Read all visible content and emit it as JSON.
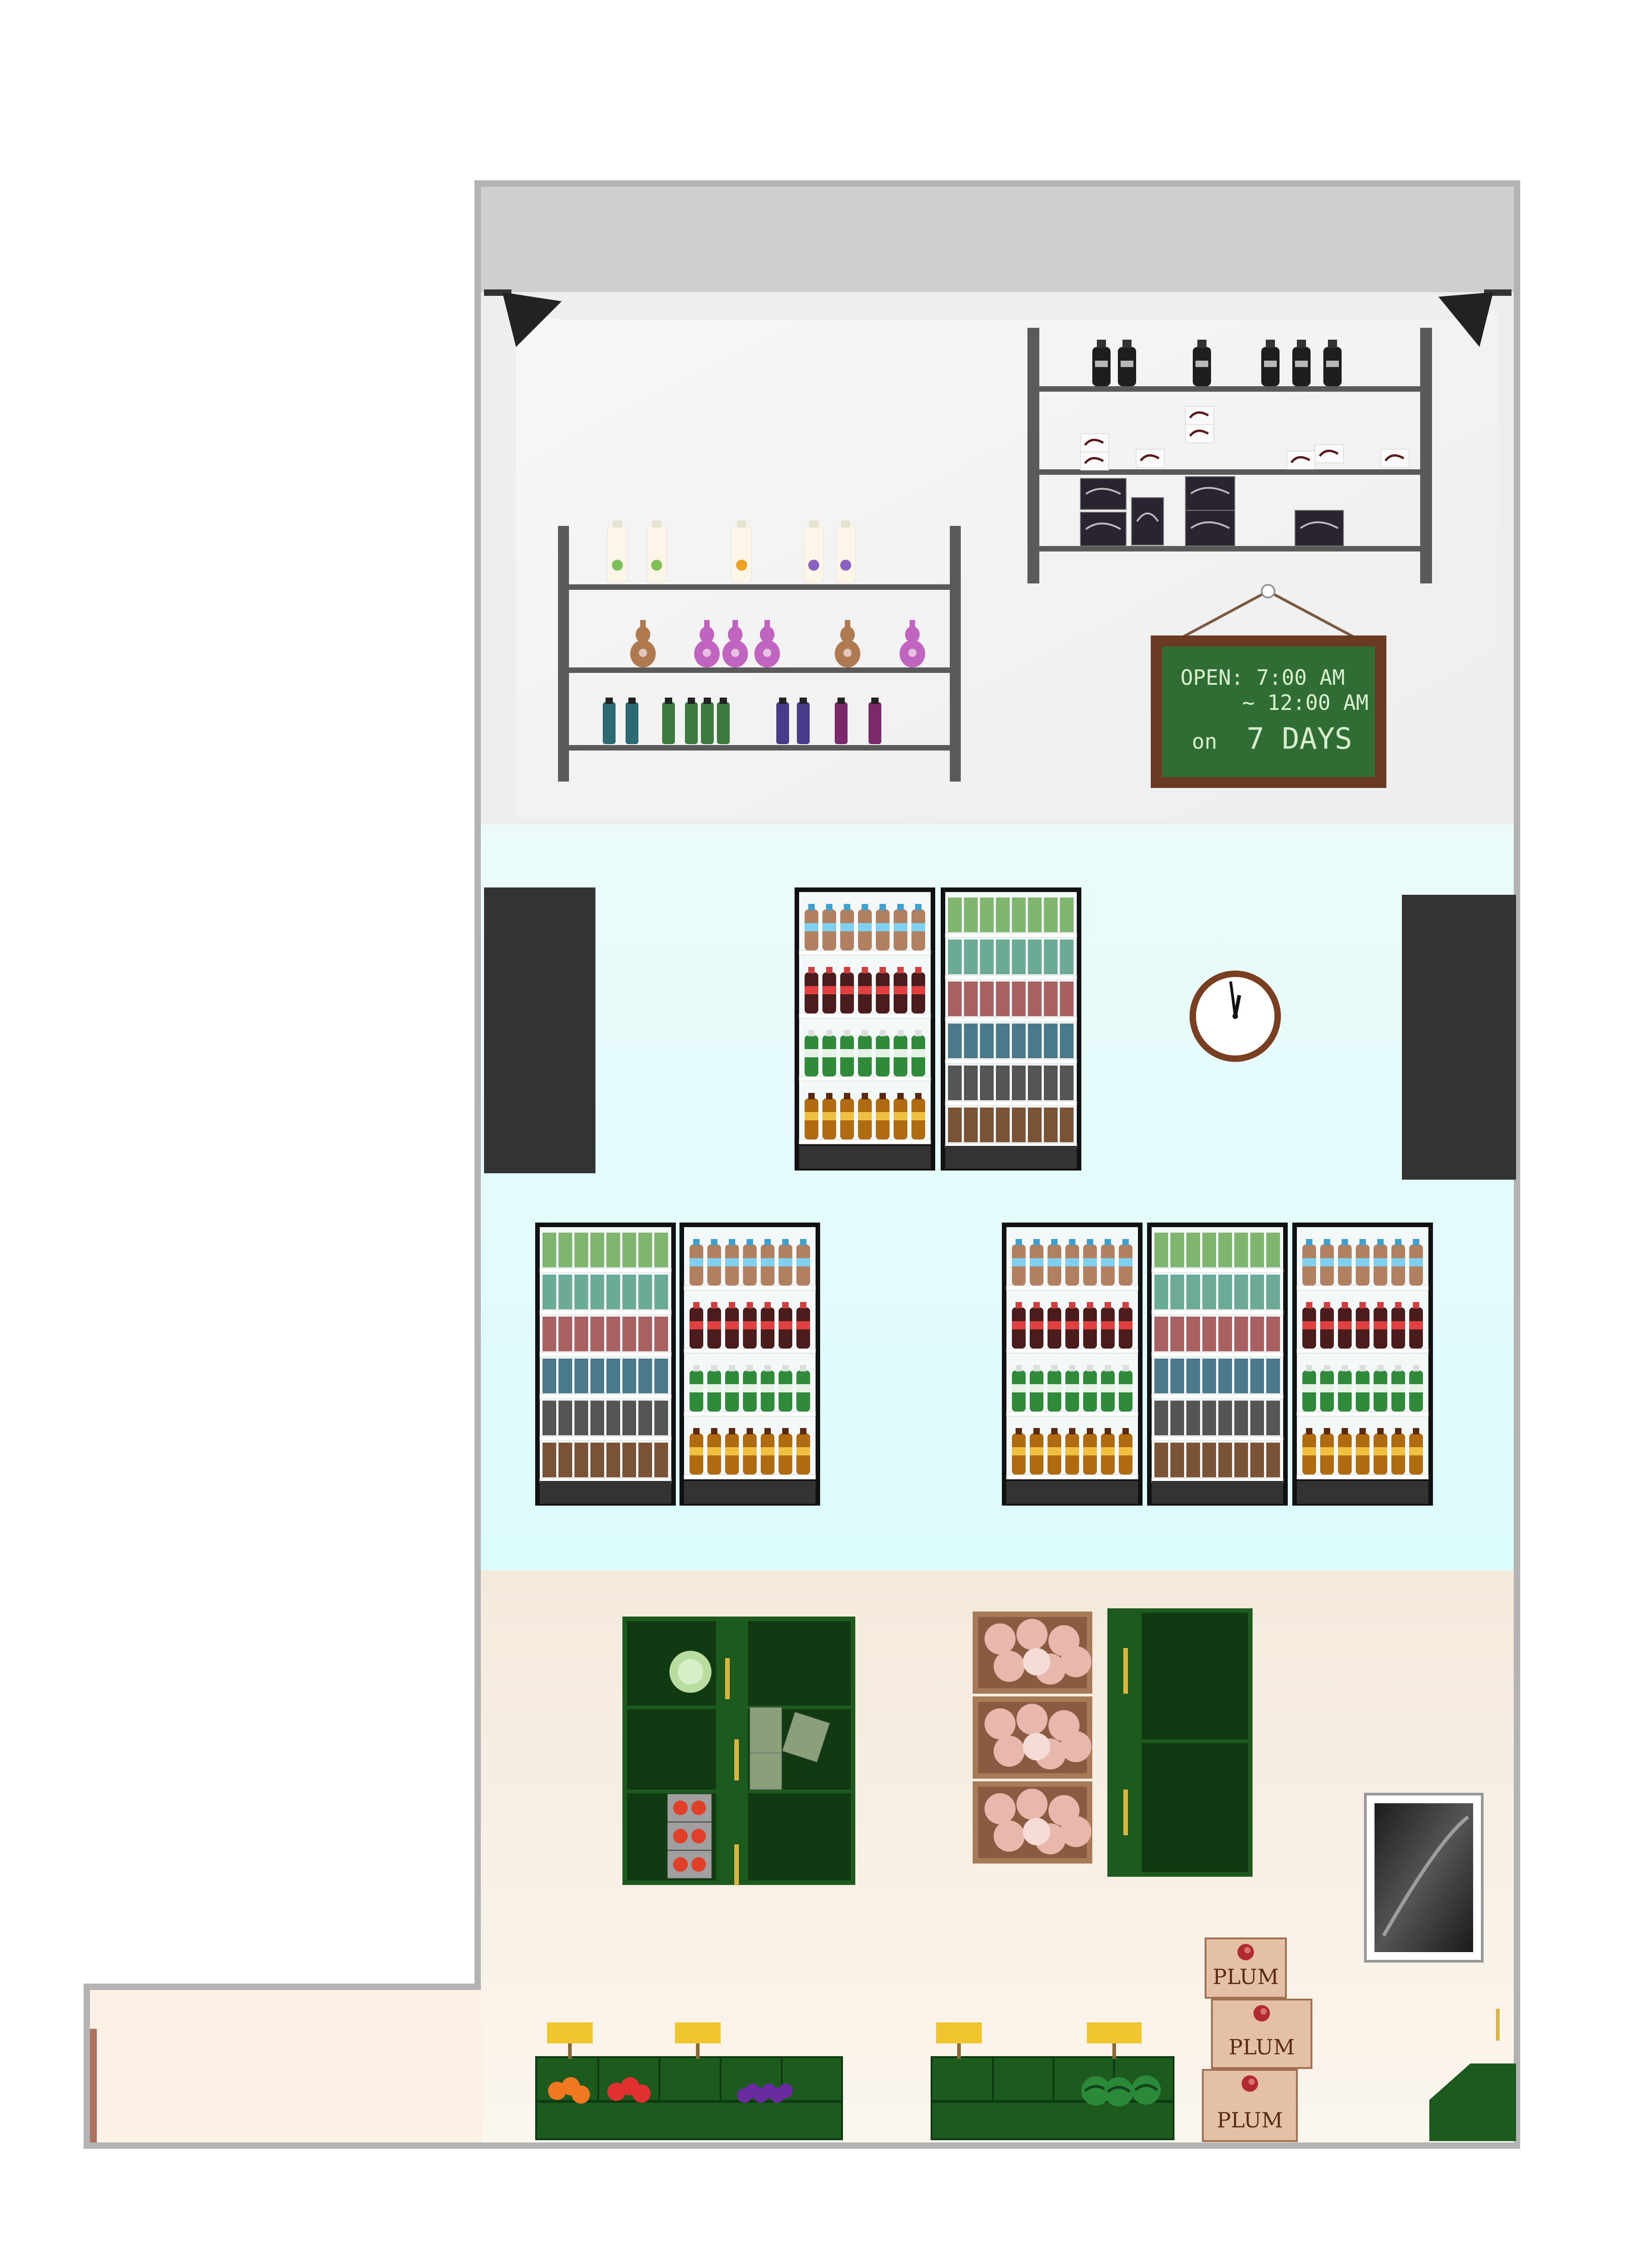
{
  "sign": {
    "line1": "OPEN: 7:00 AM",
    "line2": "~ 12:00 AM",
    "line3_prefix": "on",
    "line3_main": "7 DAYS"
  },
  "plum_box_label": "PLUM",
  "colors": {
    "wall_outline": "#b3b3b3",
    "ceiling": "#cfcfcf",
    "upper_floor": "#eeeeee",
    "middle_floor": "#e3fbfb",
    "lower_floor": "#f7f0e6",
    "shelf_metal": "#5a5a5a",
    "chalkboard": "#2f6d35",
    "chalk_frame": "#6a3a22",
    "produce_green": "#1c5a1e",
    "door_dark": "#333333",
    "price_tag": "#f0c52e"
  },
  "icons": [
    "spotlight-icon",
    "clock-icon",
    "mirror-icon",
    "cabbage-icon",
    "orange-icon",
    "tomato-icon",
    "grape-icon",
    "watermelon-icon",
    "plum-icon"
  ]
}
